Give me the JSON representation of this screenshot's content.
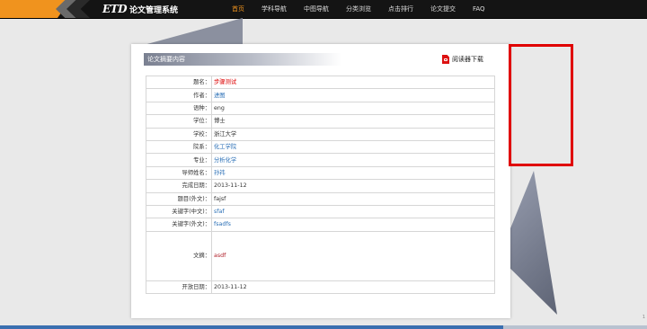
{
  "header": {
    "logo_etd": "ETD",
    "logo_sys": "论文管理系统",
    "nav": [
      "首页",
      "学科导航",
      "中图导航",
      "分类浏览",
      "点击排行",
      "论文提交",
      "FAQ"
    ],
    "active_nav": "首页"
  },
  "card": {
    "title": "论文摘要内容",
    "download_label": "阅读器下载"
  },
  "rows": [
    {
      "key": "题名：",
      "value": "步骤测试"
    },
    {
      "key": "作者：",
      "value": "进图"
    },
    {
      "key": "语种：",
      "value": "eng"
    },
    {
      "key": "学位：",
      "value": "博士"
    },
    {
      "key": "学校：",
      "value": "浙江大学"
    },
    {
      "key": "院系：",
      "value": "化工学院"
    },
    {
      "key": "专业：",
      "value": "分析化学"
    },
    {
      "key": "导师姓名：",
      "value": "孙祎"
    },
    {
      "key": "完成日期：",
      "value": "2013-11-12"
    },
    {
      "key": "题目(外文)：",
      "value": "fajsf"
    },
    {
      "key": "关键字(中文)：",
      "value": "sfaf"
    },
    {
      "key": "关键字(外文)：",
      "value": "fsadfs"
    },
    {
      "key": "文摘：",
      "value": "asdf"
    },
    {
      "key": "开放日期：",
      "value": "2013-11-12"
    }
  ],
  "page_marker": "1",
  "colors": {
    "accent_orange": "#f0931e",
    "highlight_red": "#e00000",
    "link_blue": "#2a6fb6"
  }
}
